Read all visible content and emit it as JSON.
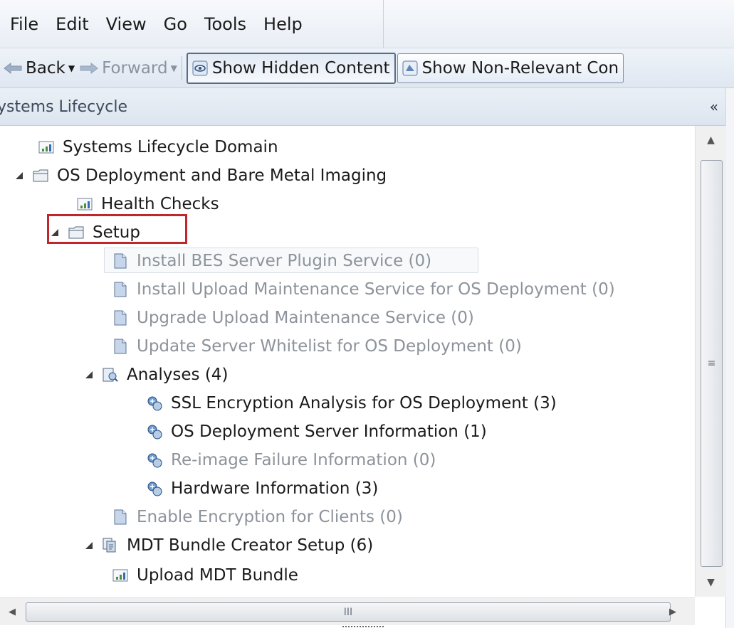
{
  "menu": [
    "File",
    "Edit",
    "View",
    "Go",
    "Tools",
    "Help"
  ],
  "toolbar": {
    "back_label": "Back",
    "forward_label": "Forward",
    "show_hidden_label": "Show Hidden Content",
    "show_nonrelevant_label": "Show Non-Relevant Con"
  },
  "panel": {
    "title": "ystems Lifecycle",
    "collapse_glyph": "«"
  },
  "tree": {
    "systems_domain": "Systems Lifecycle Domain",
    "os_deployment": "OS Deployment and Bare Metal Imaging",
    "health_checks": "Health Checks",
    "setup": "Setup",
    "install_bes": "Install BES Server Plugin Service (0)",
    "install_upload": "Install Upload Maintenance Service for OS Deployment (0)",
    "upgrade_upload": "Upgrade Upload Maintenance Service (0)",
    "update_whitelist": "Update Server Whitelist for OS Deployment (0)",
    "analyses": "Analyses (4)",
    "ssl_analysis": "SSL Encryption Analysis for OS Deployment (3)",
    "os_server_info": "OS Deployment Server Information (1)",
    "reimage_failure": "Re-image Failure Information (0)",
    "hardware_info": "Hardware Information (3)",
    "enable_encryption": "Enable Encryption for Clients (0)",
    "mdt_bundle_setup": "MDT Bundle Creator Setup (6)",
    "upload_mdt": "Upload MDT Bundle"
  },
  "scroll": {
    "grip_v": "≡",
    "grip_h": "III"
  }
}
